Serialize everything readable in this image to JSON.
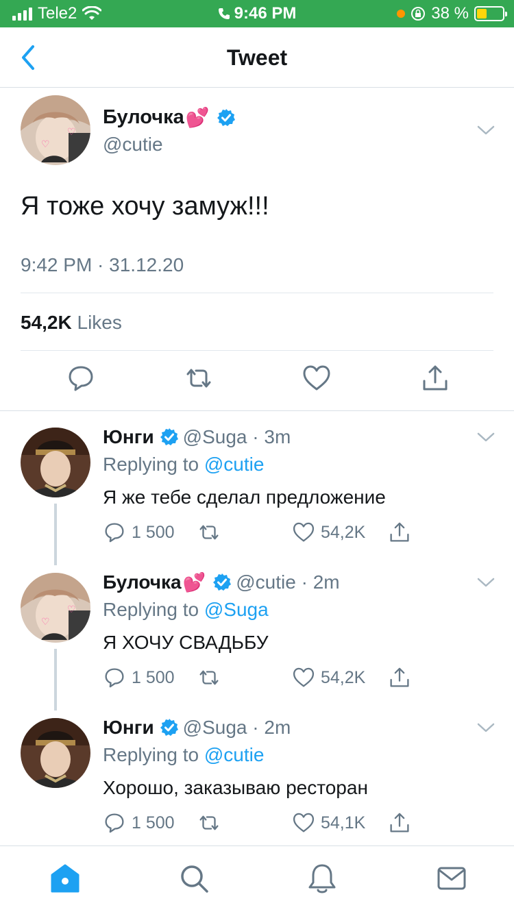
{
  "status_bar": {
    "carrier": "Tele2",
    "time": "9:46 PM",
    "battery_percent": "38 %",
    "battery_level": 0.38
  },
  "nav": {
    "title": "Tweet",
    "back_icon": "chevron-left-icon"
  },
  "main_tweet": {
    "author_name": "Булочка",
    "name_emoji": "💕",
    "handle": "@cutie",
    "text": "Я тоже хочу замуж!!!",
    "timestamp": "9:42 PM · 31.12.20",
    "likes_count": "54,2K",
    "likes_label": "Likes"
  },
  "replies": [
    {
      "author_name": "Юнги",
      "name_emoji": "",
      "meta": "@Suga · 3m",
      "replying_prefix": "Replying to",
      "replying_handle": "@cutie",
      "text": "Я же тебе сделал предложение",
      "reply_count": "1 500",
      "like_count": "54,2K"
    },
    {
      "author_name": "Булочка",
      "name_emoji": "💕",
      "meta": "@cutie · 2m",
      "replying_prefix": "Replying to",
      "replying_handle": "@Suga",
      "text": "Я ХОЧУ СВАДЬБУ",
      "reply_count": "1 500",
      "like_count": "54,2K"
    },
    {
      "author_name": "Юнги",
      "name_emoji": "",
      "meta": "@Suga · 2m",
      "replying_prefix": "Replying to",
      "replying_handle": "@cutie",
      "text": "Хорошо, заказываю ресторан",
      "reply_count": "1 500",
      "like_count": "54,1K"
    }
  ],
  "colors": {
    "accent": "#1da1f2",
    "status_bar": "#34a853",
    "secondary_text": "#657786"
  },
  "tab_bar": [
    "home-icon",
    "search-icon",
    "notifications-icon",
    "messages-icon"
  ]
}
